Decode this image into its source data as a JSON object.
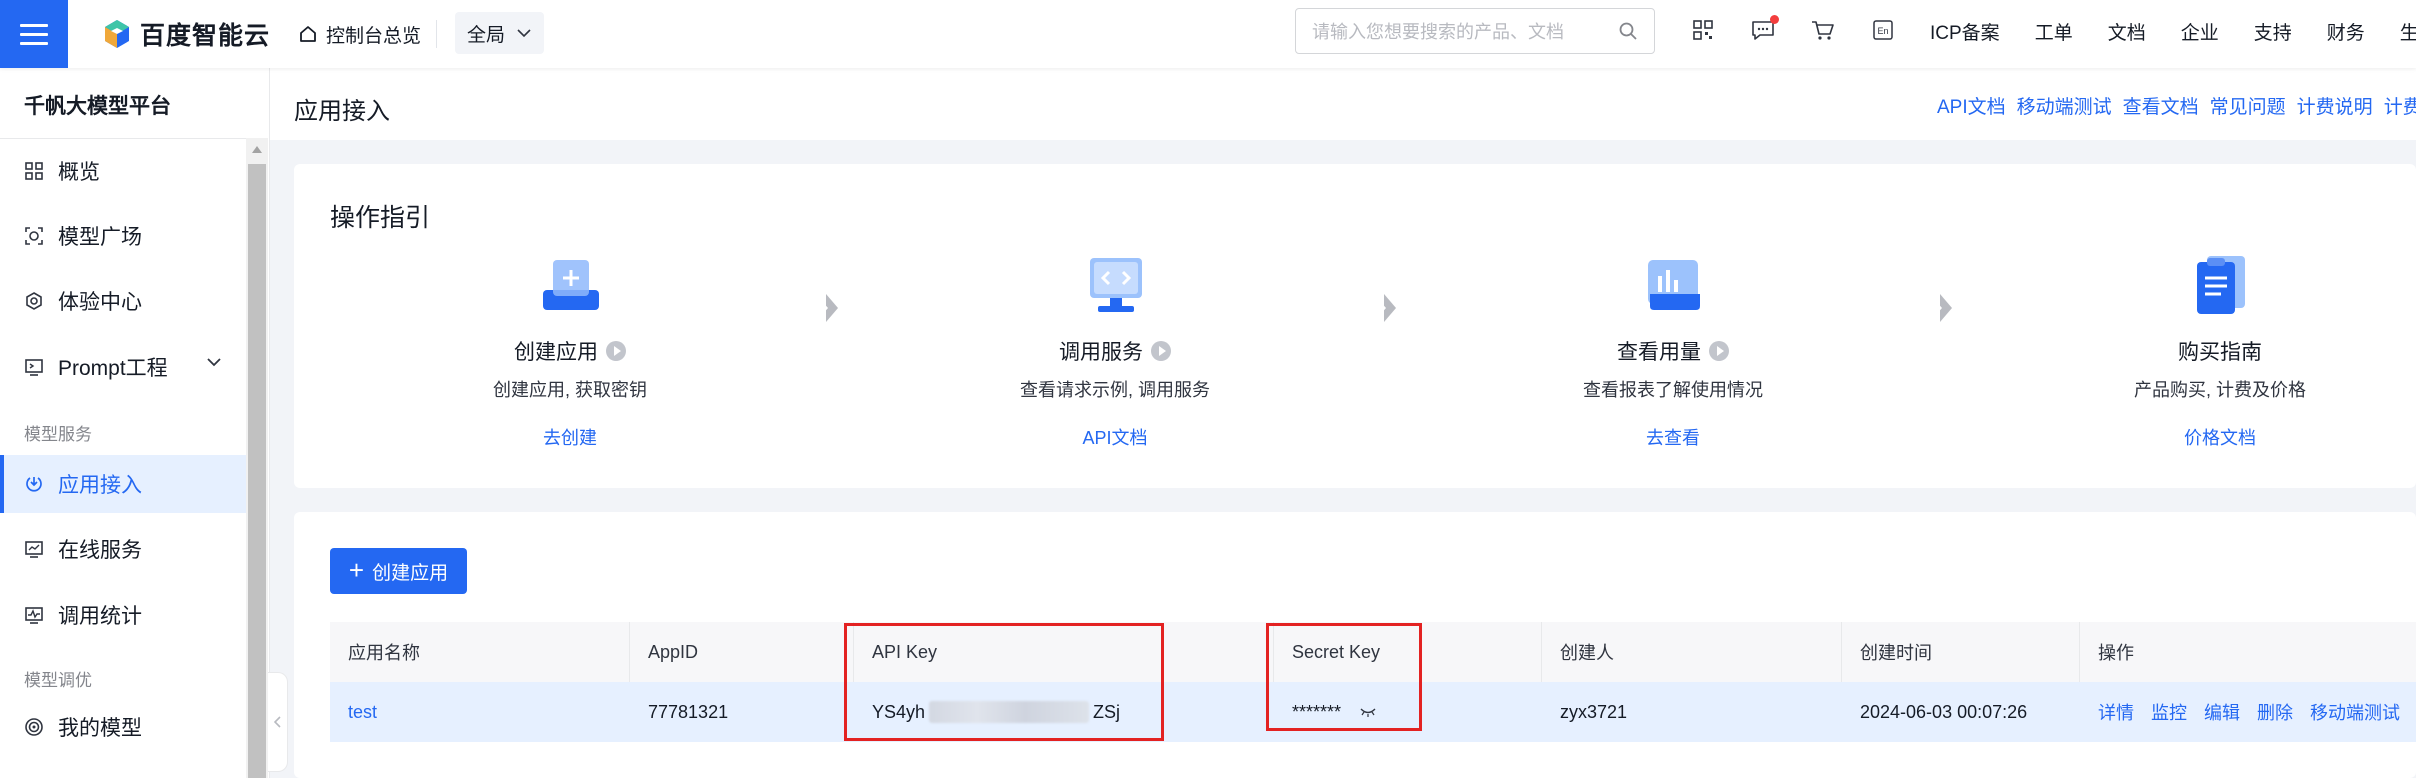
{
  "topbar": {
    "brand": "百度智能云",
    "console_link": "控制台总览",
    "region": "全局",
    "search_placeholder": "请输入您想要搜索的产品、文档",
    "nav": [
      "ICP备案",
      "工单",
      "文档",
      "企业",
      "支持",
      "财务",
      "生态"
    ],
    "icons": [
      "qrcode-icon",
      "message-icon",
      "cart-icon",
      "language-en-icon"
    ]
  },
  "sidebar": {
    "title": "千帆大模型平台",
    "items_top": [
      {
        "label": "概览",
        "icon": "overview-grid-icon"
      },
      {
        "label": "模型广场",
        "icon": "model-square-icon"
      },
      {
        "label": "体验中心",
        "icon": "experience-icon"
      },
      {
        "label": "Prompt工程",
        "icon": "prompt-icon"
      }
    ],
    "group1": "模型服务",
    "items_service": [
      {
        "label": "应用接入",
        "icon": "app-access-icon"
      },
      {
        "label": "在线服务",
        "icon": "online-service-icon"
      },
      {
        "label": "调用统计",
        "icon": "call-stats-icon"
      }
    ],
    "group2": "模型调优",
    "items_tune": [
      {
        "label": "我的模型",
        "icon": "my-model-icon"
      }
    ]
  },
  "header": {
    "title": "应用接入",
    "links": [
      "API文档",
      "移动端测试",
      "查看文档",
      "常见问题",
      "计费说明",
      "计费管理"
    ]
  },
  "guide": {
    "title": "操作指引",
    "steps": [
      {
        "name": "创建应用",
        "desc": "创建应用, 获取密钥",
        "link": "去创建"
      },
      {
        "name": "调用服务",
        "desc": "查看请求示例, 调用服务",
        "link": "API文档"
      },
      {
        "name": "查看用量",
        "desc": "查看报表了解使用情况",
        "link": "去查看"
      },
      {
        "name": "购买指南",
        "desc": "产品购买, 计费及价格",
        "link": "价格文档"
      }
    ]
  },
  "apps": {
    "create_button": "创建应用",
    "columns": [
      "应用名称",
      "AppID",
      "API Key",
      "Secret Key",
      "创建人",
      "创建时间",
      "操作"
    ],
    "rows": [
      {
        "name": "test",
        "app_id": "77781321",
        "api_key_prefix": "YS4yh",
        "api_key_suffix": "ZSj",
        "secret_key": "*******",
        "creator": "zyx3721",
        "created": "2024-06-03 00:07:26",
        "actions": [
          "详情",
          "监控",
          "编辑",
          "删除",
          "移动端测试"
        ]
      }
    ]
  },
  "colors": {
    "accent": "#2468f2",
    "highlight": "#e32222",
    "row_bg": "#e6f0ff"
  }
}
